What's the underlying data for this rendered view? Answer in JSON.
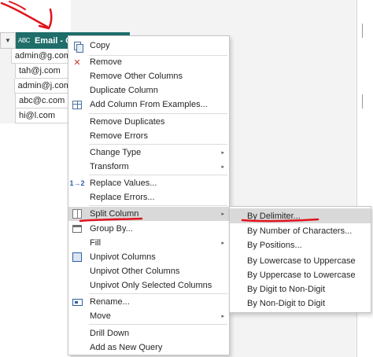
{
  "column": {
    "type_badge": "ABC",
    "title": "Email - Co",
    "filter_glyph": "▼"
  },
  "rows": [
    {
      "value": "admin@g.com"
    },
    {
      "value": "tah@j.com"
    },
    {
      "value": "admin@j.com"
    },
    {
      "value": "abc@c.com"
    },
    {
      "value": "hi@l.com"
    }
  ],
  "menu": {
    "items": [
      {
        "label": "Copy",
        "icon": "copy-icon"
      },
      {
        "label": "Remove",
        "icon": "remove-icon"
      },
      {
        "label": "Remove Other Columns"
      },
      {
        "label": "Duplicate Column"
      },
      {
        "label": "Add Column From Examples...",
        "icon": "add-column-examples-icon"
      },
      {
        "label": "Remove Duplicates"
      },
      {
        "label": "Remove Errors"
      },
      {
        "label": "Change Type",
        "submenu": true
      },
      {
        "label": "Transform",
        "submenu": true
      },
      {
        "label": "Replace Values...",
        "icon": "replace-values-icon"
      },
      {
        "label": "Replace Errors..."
      },
      {
        "label": "Split Column",
        "icon": "split-column-icon",
        "submenu": true,
        "active": true
      },
      {
        "label": "Group By...",
        "icon": "group-by-icon"
      },
      {
        "label": "Fill",
        "submenu": true
      },
      {
        "label": "Unpivot Columns",
        "icon": "unpivot-icon"
      },
      {
        "label": "Unpivot Other Columns"
      },
      {
        "label": "Unpivot Only Selected Columns"
      },
      {
        "label": "Rename...",
        "icon": "rename-icon"
      },
      {
        "label": "Move",
        "submenu": true
      },
      {
        "label": "Drill Down"
      },
      {
        "label": "Add as New Query"
      }
    ],
    "arrow_glyph": "▸",
    "replace_glyph": "1→2"
  },
  "submenu": {
    "items": [
      {
        "label": "By Delimiter...",
        "active": true
      },
      {
        "label": "By Number of Characters..."
      },
      {
        "label": "By Positions..."
      },
      {
        "label": "By Lowercase to Uppercase"
      },
      {
        "label": "By Uppercase to Lowercase"
      },
      {
        "label": "By Digit to Non-Digit"
      },
      {
        "label": "By Non-Digit to Digit"
      }
    ]
  },
  "colors": {
    "header_bg": "#1f6e6a",
    "highlight": "#d9d9d9",
    "annotation": "#e0141e"
  }
}
